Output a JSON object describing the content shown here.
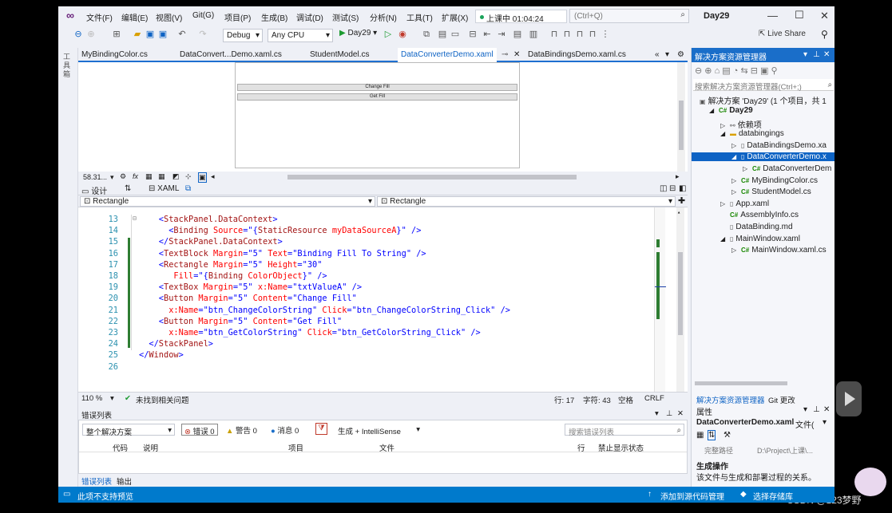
{
  "menu": {
    "items": [
      "文件(F)",
      "编辑(E)",
      "视图(V)",
      "Git(G)",
      "项目(P)",
      "生成(B)",
      "调试(D)",
      "测试(S)",
      "分析(N)",
      "工具(T)",
      "扩展(X)"
    ],
    "timer": "上课中 01:04:24",
    "search_placeholder": "(Ctrl+Q)",
    "window_title": "Day29"
  },
  "toolbar": {
    "config": "Debug",
    "platform": "Any CPU",
    "run_label": "Day29",
    "live_share": "Live Share"
  },
  "left_strip": {
    "label": "工具箱"
  },
  "tabs": [
    "MyBindingColor.cs",
    "DataConvert...Demo.xaml.cs",
    "StudentModel.cs",
    "DataConverterDemo.xaml",
    "DataBindingsDemo.xaml.cs"
  ],
  "active_tab": "DataConverterDemo.xaml",
  "design": {
    "button1": "Change Fill",
    "button2": "Get Fill"
  },
  "zoom": {
    "value": "58.31..."
  },
  "split": {
    "design": "设计",
    "xaml": "XAML"
  },
  "nav": {
    "left": "Rectangle",
    "right": "Rectangle"
  },
  "code_lines": [
    {
      "n": "13",
      "indent": 4,
      "html": "<span class='br'>&lt;</span><span class='tag'>StackPanel.DataContext</span><span class='br'>&gt;</span>"
    },
    {
      "n": "14",
      "indent": 6,
      "html": "<span class='br'>&lt;</span><span class='tag'>Binding</span> <span class='at'>Source</span><span class='br'>=\"{</span><span class='tag'>StaticResource</span> <span class='at'>myDataSourceA</span><span class='br'>}\" /&gt;</span>"
    },
    {
      "n": "15",
      "indent": 4,
      "html": "<span class='br'>&lt;/</span><span class='tag'>StackPanel.DataContext</span><span class='br'>&gt;</span>"
    },
    {
      "n": "16",
      "indent": 4,
      "html": "<span class='br'>&lt;</span><span class='tag'>TextBlock</span> <span class='at'>Margin</span><span class='br'>=\"5\"</span> <span class='at'>Text</span><span class='br'>=\"Binding Fill To String\" /&gt;</span>"
    },
    {
      "n": "17",
      "indent": 4,
      "html": "<span class='br'>&lt;</span><span class='tag'>Rectangle</span> <span class='at'>Margin</span><span class='br'>=\"5\"</span> <span class='at'>Height</span><span class='br'>=\"30\"</span>"
    },
    {
      "n": "18",
      "indent": 7,
      "html": "<span class='at'>Fill</span><span class='br'>=\"{</span><span class='tag'>Binding</span> <span class='at'>ColorObject</span><span class='br'>}\" /&gt;</span>"
    },
    {
      "n": "19",
      "indent": 4,
      "html": "<span class='br'>&lt;</span><span class='tag'>TextBox</span> <span class='at'>Margin</span><span class='br'>=\"5\"</span> <span class='at'>x:Name</span><span class='br'>=\"txtValueA\" /&gt;</span>"
    },
    {
      "n": "20",
      "indent": 4,
      "html": "<span class='br'>&lt;</span><span class='tag'>Button</span> <span class='at'>Margin</span><span class='br'>=\"5\"</span> <span class='at'>Content</span><span class='br'>=\"Change Fill\"</span>"
    },
    {
      "n": "21",
      "indent": 6,
      "html": "<span class='at'>x:Name</span><span class='br'>=\"btn_ChangeColorString\"</span> <span class='at'>Click</span><span class='br'>=\"btn_ChangeColorString_Click\" /&gt;</span>"
    },
    {
      "n": "22",
      "indent": 4,
      "html": "<span class='br'>&lt;</span><span class='tag'>Button</span> <span class='at'>Margin</span><span class='br'>=\"5\"</span> <span class='at'>Content</span><span class='br'>=\"Get Fill\"</span>"
    },
    {
      "n": "23",
      "indent": 6,
      "html": "<span class='at'>x:Name</span><span class='br'>=\"btn_GetColorString\"</span> <span class='at'>Click</span><span class='br'>=\"btn_GetColorString_Click\" /&gt;</span>"
    },
    {
      "n": "24",
      "indent": 2,
      "html": "<span class='br'>&lt;/</span><span class='tag'>StackPanel</span><span class='br'>&gt;</span>"
    },
    {
      "n": "25",
      "indent": 0,
      "html": "<span class='br'>&lt;/</span><span class='tag'>Window</span><span class='br'>&gt;</span>"
    },
    {
      "n": "26",
      "indent": 0,
      "html": ""
    }
  ],
  "editor_status": {
    "zoom": "110 %",
    "issues": "未找到相关问题",
    "line": "行: 17",
    "char": "字符: 43",
    "space": "空格",
    "eol": "CRLF"
  },
  "error_list": {
    "title": "错误列表",
    "scope": "整个解决方案",
    "errors": "错误 0",
    "warnings": "警告 0",
    "messages": "消息 0",
    "build": "生成 + IntelliSense",
    "search": "搜索错误列表",
    "columns": [
      "代码",
      "说明",
      "项目",
      "文件",
      "行",
      "禁止显示状态"
    ],
    "tab1": "错误列表",
    "tab2": "输出"
  },
  "statusbar": {
    "left": "此项不支持预览",
    "add_source": "添加到源代码管理",
    "select_repo": "选择存储库"
  },
  "solution_explorer": {
    "title": "解决方案资源管理器",
    "search": "搜索解决方案资源管理器(Ctrl+;)",
    "solution": "解决方案 'Day29' (1 个项目，共 1",
    "items": [
      {
        "label": "Day29",
        "depth": 1,
        "arrow": "◢",
        "icon": "C#",
        "bold": true
      },
      {
        "label": "依赖项",
        "depth": 2,
        "arrow": "▷",
        "icon": "dep"
      },
      {
        "label": "databingings",
        "depth": 2,
        "arrow": "◢",
        "icon": "folder"
      },
      {
        "label": "DataBindingsDemo.xa",
        "depth": 3,
        "arrow": "▷",
        "icon": "xaml"
      },
      {
        "label": "DataConverterDemo.x",
        "depth": 3,
        "arrow": "◢",
        "icon": "xaml",
        "selected": true
      },
      {
        "label": "DataConverterDem",
        "depth": 4,
        "arrow": "▷",
        "icon": "C#"
      },
      {
        "label": "MyBindingColor.cs",
        "depth": 3,
        "arrow": "▷",
        "icon": "C#"
      },
      {
        "label": "StudentModel.cs",
        "depth": 3,
        "arrow": "▷",
        "icon": "C#"
      },
      {
        "label": "App.xaml",
        "depth": 2,
        "arrow": "▷",
        "icon": "xaml"
      },
      {
        "label": "AssemblyInfo.cs",
        "depth": 2,
        "arrow": "",
        "icon": "C#"
      },
      {
        "label": "DataBinding.md",
        "depth": 2,
        "arrow": "",
        "icon": "md"
      },
      {
        "label": "MainWindow.xaml",
        "depth": 2,
        "arrow": "◢",
        "icon": "xaml"
      },
      {
        "label": "MainWindow.xaml.cs",
        "depth": 3,
        "arrow": "▷",
        "icon": "C#"
      }
    ],
    "tab1": "解决方案资源管理器",
    "tab2": "Git 更改"
  },
  "properties": {
    "title": "属性",
    "file": "DataConverterDemo.xaml",
    "file_kind": "文件(",
    "path_label": "完整路径",
    "path_value": "D:\\Project\\上课\\...",
    "section": "生成操作",
    "desc": "该文件与生成和部署过程的关系。"
  },
  "watermark": "CSDN @123梦野"
}
